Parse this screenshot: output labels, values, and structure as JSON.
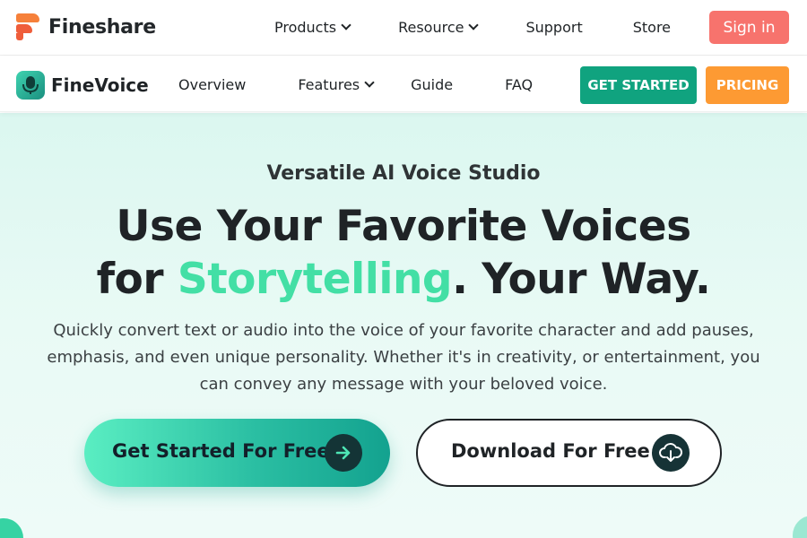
{
  "brand": {
    "name": "Fineshare",
    "logo_icon": "fineshare-logo-icon"
  },
  "top_nav": {
    "links": [
      {
        "label": "Products",
        "has_dropdown": true
      },
      {
        "label": "Resource",
        "has_dropdown": true
      },
      {
        "label": "Support",
        "has_dropdown": false
      },
      {
        "label": "Store",
        "has_dropdown": false
      }
    ],
    "signin_label": "Sign in",
    "signin_color": "#f7736d"
  },
  "sub_nav": {
    "product_name": "FineVoice",
    "product_icon": "microphone-icon",
    "links": [
      {
        "label": "Overview",
        "has_dropdown": false
      },
      {
        "label": "Features",
        "has_dropdown": true
      },
      {
        "label": "Guide",
        "has_dropdown": false
      },
      {
        "label": "FAQ",
        "has_dropdown": false
      }
    ],
    "get_started_label": "GET STARTED",
    "pricing_label": "PRICING",
    "get_started_color": "#10a37f",
    "pricing_color": "#fd9a33"
  },
  "hero": {
    "eyebrow": "Versatile AI Voice Studio",
    "headline_line1": "Use Your Favorite Voices",
    "headline_line2_prefix": "for ",
    "headline_line2_accent": "Storytelling",
    "headline_line2_suffix": ". Your Way.",
    "accent_color": "#43dfa5",
    "description": "Quickly convert text or audio into the voice of your favorite character and add pauses, emphasis, and even unique personality. Whether it's in creativity, or entertainment, you can convey any message with your beloved voice.",
    "cta_primary_label": "Get Started For Free",
    "cta_primary_icon": "arrow-right-icon",
    "cta_secondary_label": "Download For Free",
    "cta_secondary_icon": "cloud-download-icon"
  }
}
